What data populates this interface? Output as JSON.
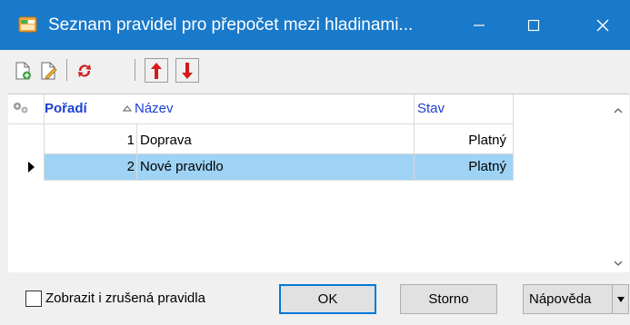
{
  "window": {
    "title": "Seznam pravidel pro přepočet mezi hladinami..."
  },
  "toolbar": {
    "tools": [
      {
        "name": "new-icon"
      },
      {
        "name": "edit-icon"
      },
      {
        "name": "refresh-icon"
      },
      {
        "name": "move-up-icon"
      },
      {
        "name": "move-down-icon"
      }
    ]
  },
  "grid": {
    "columns": {
      "order": "Pořadí",
      "name": "Název",
      "state": "Stav"
    },
    "rows": [
      {
        "order": "1",
        "name": "Doprava",
        "state": "Platný",
        "selected": false
      },
      {
        "order": "2",
        "name": "Nové pravidlo",
        "state": "Platný",
        "selected": true
      }
    ]
  },
  "footer": {
    "show_cancelled_label": "Zobrazit i zrušená pravidla",
    "show_cancelled_checked": false,
    "ok_label": "OK",
    "cancel_label": "Storno",
    "help_label": "Nápověda"
  },
  "colors": {
    "titlebar": "#1979ca",
    "header_link": "#1a3fd6",
    "selected_row": "#9fd3f5",
    "arrow_red": "#d51a1a"
  }
}
